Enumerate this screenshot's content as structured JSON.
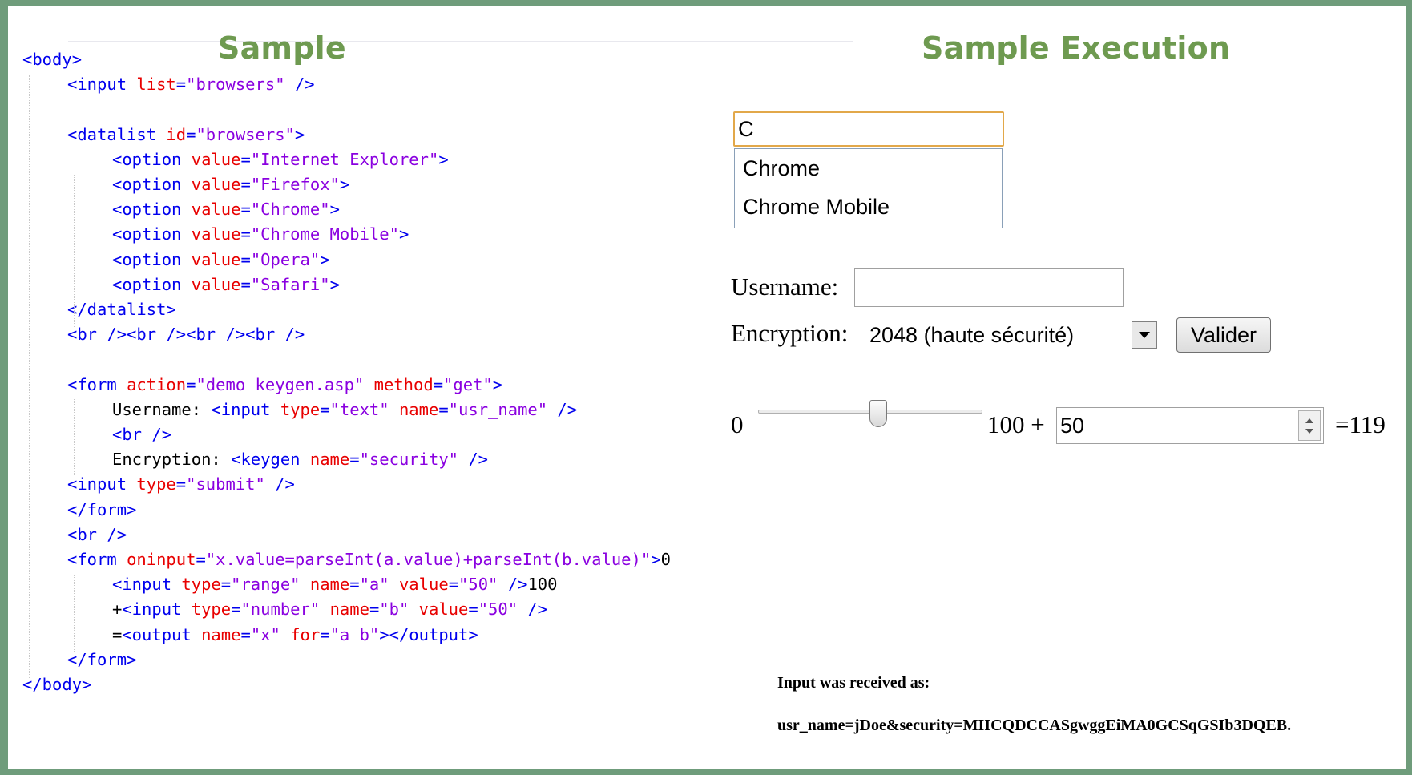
{
  "headings": {
    "sample": "Sample",
    "execution": "Sample Execution"
  },
  "code": {
    "lines": [
      {
        "indent": 0,
        "tokens": [
          {
            "t": "tag",
            "s": "<body>"
          }
        ]
      },
      {
        "indent": 1,
        "tokens": [
          {
            "t": "tag",
            "s": "<input "
          },
          {
            "t": "attr",
            "s": "list"
          },
          {
            "t": "tag",
            "s": "="
          },
          {
            "t": "str",
            "s": "\"browsers\""
          },
          {
            "t": "tag",
            "s": " />"
          }
        ]
      },
      {
        "indent": 1,
        "tokens": []
      },
      {
        "indent": 1,
        "tokens": [
          {
            "t": "tag",
            "s": "<datalist "
          },
          {
            "t": "attr",
            "s": "id"
          },
          {
            "t": "tag",
            "s": "="
          },
          {
            "t": "str",
            "s": "\"browsers\""
          },
          {
            "t": "tag",
            "s": ">"
          }
        ]
      },
      {
        "indent": 2,
        "tokens": [
          {
            "t": "tag",
            "s": "<option "
          },
          {
            "t": "attr",
            "s": "value"
          },
          {
            "t": "tag",
            "s": "="
          },
          {
            "t": "str",
            "s": "\"Internet Explorer\""
          },
          {
            "t": "tag",
            "s": ">"
          }
        ]
      },
      {
        "indent": 2,
        "tokens": [
          {
            "t": "tag",
            "s": "<option "
          },
          {
            "t": "attr",
            "s": "value"
          },
          {
            "t": "tag",
            "s": "="
          },
          {
            "t": "str",
            "s": "\"Firefox\""
          },
          {
            "t": "tag",
            "s": ">"
          }
        ]
      },
      {
        "indent": 2,
        "tokens": [
          {
            "t": "tag",
            "s": "<option "
          },
          {
            "t": "attr",
            "s": "value"
          },
          {
            "t": "tag",
            "s": "="
          },
          {
            "t": "str",
            "s": "\"Chrome\""
          },
          {
            "t": "tag",
            "s": ">"
          }
        ]
      },
      {
        "indent": 2,
        "tokens": [
          {
            "t": "tag",
            "s": "<option "
          },
          {
            "t": "attr",
            "s": "value"
          },
          {
            "t": "tag",
            "s": "="
          },
          {
            "t": "str",
            "s": "\"Chrome Mobile\""
          },
          {
            "t": "tag",
            "s": ">"
          }
        ]
      },
      {
        "indent": 2,
        "tokens": [
          {
            "t": "tag",
            "s": "<option "
          },
          {
            "t": "attr",
            "s": "value"
          },
          {
            "t": "tag",
            "s": "="
          },
          {
            "t": "str",
            "s": "\"Opera\""
          },
          {
            "t": "tag",
            "s": ">"
          }
        ]
      },
      {
        "indent": 2,
        "tokens": [
          {
            "t": "tag",
            "s": "<option "
          },
          {
            "t": "attr",
            "s": "value"
          },
          {
            "t": "tag",
            "s": "="
          },
          {
            "t": "str",
            "s": "\"Safari\""
          },
          {
            "t": "tag",
            "s": ">"
          }
        ]
      },
      {
        "indent": 1,
        "tokens": [
          {
            "t": "tag",
            "s": "</datalist>"
          }
        ]
      },
      {
        "indent": 1,
        "tokens": [
          {
            "t": "tag",
            "s": "<br /><br /><br /><br />"
          }
        ]
      },
      {
        "indent": 1,
        "tokens": []
      },
      {
        "indent": 1,
        "tokens": [
          {
            "t": "tag",
            "s": "<form "
          },
          {
            "t": "attr",
            "s": "action"
          },
          {
            "t": "tag",
            "s": "="
          },
          {
            "t": "str",
            "s": "\"demo_keygen.asp\""
          },
          {
            "t": "tag",
            "s": " "
          },
          {
            "t": "attr",
            "s": "method"
          },
          {
            "t": "tag",
            "s": "="
          },
          {
            "t": "str",
            "s": "\"get\""
          },
          {
            "t": "tag",
            "s": ">"
          }
        ]
      },
      {
        "indent": 2,
        "tokens": [
          {
            "t": "txt",
            "s": "Username: "
          },
          {
            "t": "tag",
            "s": "<input "
          },
          {
            "t": "attr",
            "s": "type"
          },
          {
            "t": "tag",
            "s": "="
          },
          {
            "t": "str",
            "s": "\"text\""
          },
          {
            "t": "tag",
            "s": " "
          },
          {
            "t": "attr",
            "s": "name"
          },
          {
            "t": "tag",
            "s": "="
          },
          {
            "t": "str",
            "s": "\"usr_name\""
          },
          {
            "t": "tag",
            "s": " />"
          }
        ]
      },
      {
        "indent": 2,
        "tokens": [
          {
            "t": "tag",
            "s": "<br />"
          }
        ]
      },
      {
        "indent": 2,
        "tokens": [
          {
            "t": "txt",
            "s": "Encryption: "
          },
          {
            "t": "tag",
            "s": "<keygen "
          },
          {
            "t": "attr",
            "s": "name"
          },
          {
            "t": "tag",
            "s": "="
          },
          {
            "t": "str",
            "s": "\"security\""
          },
          {
            "t": "tag",
            "s": " />"
          }
        ]
      },
      {
        "indent": 1,
        "tokens": [
          {
            "t": "tag",
            "s": "<input "
          },
          {
            "t": "attr",
            "s": "type"
          },
          {
            "t": "tag",
            "s": "="
          },
          {
            "t": "str",
            "s": "\"submit\""
          },
          {
            "t": "tag",
            "s": " />"
          }
        ]
      },
      {
        "indent": 1,
        "tokens": [
          {
            "t": "tag",
            "s": "</form>"
          }
        ]
      },
      {
        "indent": 1,
        "tokens": [
          {
            "t": "tag",
            "s": "<br />"
          }
        ]
      },
      {
        "indent": 1,
        "tokens": [
          {
            "t": "tag",
            "s": "<form "
          },
          {
            "t": "attr",
            "s": "oninput"
          },
          {
            "t": "tag",
            "s": "="
          },
          {
            "t": "str",
            "s": "\"x.value=parseInt(a.value)+parseInt(b.value)\""
          },
          {
            "t": "tag",
            "s": ">"
          },
          {
            "t": "txt",
            "s": "0"
          }
        ]
      },
      {
        "indent": 2,
        "tokens": [
          {
            "t": "tag",
            "s": "<input "
          },
          {
            "t": "attr",
            "s": "type"
          },
          {
            "t": "tag",
            "s": "="
          },
          {
            "t": "str",
            "s": "\"range\""
          },
          {
            "t": "tag",
            "s": " "
          },
          {
            "t": "attr",
            "s": "name"
          },
          {
            "t": "tag",
            "s": "="
          },
          {
            "t": "str",
            "s": "\"a\""
          },
          {
            "t": "tag",
            "s": " "
          },
          {
            "t": "attr",
            "s": "value"
          },
          {
            "t": "tag",
            "s": "="
          },
          {
            "t": "str",
            "s": "\"50\""
          },
          {
            "t": "tag",
            "s": " />"
          },
          {
            "t": "txt",
            "s": "100"
          }
        ]
      },
      {
        "indent": 2,
        "tokens": [
          {
            "t": "txt",
            "s": "+"
          },
          {
            "t": "tag",
            "s": "<input "
          },
          {
            "t": "attr",
            "s": "type"
          },
          {
            "t": "tag",
            "s": "="
          },
          {
            "t": "str",
            "s": "\"number\""
          },
          {
            "t": "tag",
            "s": " "
          },
          {
            "t": "attr",
            "s": "name"
          },
          {
            "t": "tag",
            "s": "="
          },
          {
            "t": "str",
            "s": "\"b\""
          },
          {
            "t": "tag",
            "s": " "
          },
          {
            "t": "attr",
            "s": "value"
          },
          {
            "t": "tag",
            "s": "="
          },
          {
            "t": "str",
            "s": "\"50\""
          },
          {
            "t": "tag",
            "s": " />"
          }
        ]
      },
      {
        "indent": 2,
        "tokens": [
          {
            "t": "txt",
            "s": "="
          },
          {
            "t": "tag",
            "s": "<output "
          },
          {
            "t": "attr",
            "s": "name"
          },
          {
            "t": "tag",
            "s": "="
          },
          {
            "t": "str",
            "s": "\"x\""
          },
          {
            "t": "tag",
            "s": " "
          },
          {
            "t": "attr",
            "s": "for"
          },
          {
            "t": "tag",
            "s": "="
          },
          {
            "t": "str",
            "s": "\"a b\""
          },
          {
            "t": "tag",
            "s": "></output>"
          }
        ]
      },
      {
        "indent": 1,
        "tokens": [
          {
            "t": "tag",
            "s": "</form>"
          }
        ]
      },
      {
        "indent": 0,
        "tokens": [
          {
            "t": "tag",
            "s": "</body>"
          }
        ]
      }
    ]
  },
  "execution": {
    "datalist_input_value": "C",
    "datalist_options": [
      "Chrome",
      "Chrome Mobile"
    ],
    "username_label": "Username:",
    "username_value": "",
    "encryption_label": "Encryption:",
    "encryption_selected": "2048 (haute sécurité)",
    "submit_label": "Valider",
    "range_min_label": "0",
    "range_value": 50,
    "range_max_label": "100 +",
    "number_value": "50",
    "output_text": "=119",
    "received_title": "Input was received as:",
    "received_value": "usr_name=jDoe&security=MIICQDCCASgwggEiMA0GCSqGSIb3DQEB."
  },
  "colors": {
    "frame": "#6f9c7b",
    "heading": "#6e9a50",
    "tag": "#0000ee",
    "attr": "#e80000",
    "string": "#8a00e0",
    "datalist_focus": "#e2a84a"
  }
}
